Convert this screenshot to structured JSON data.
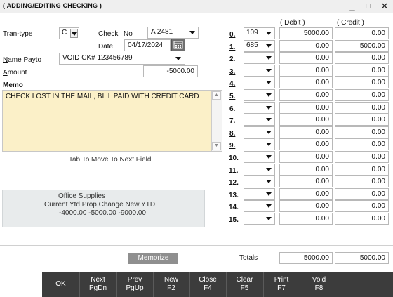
{
  "window": {
    "title": "( ADDING/EDITING CHECKING )",
    "minimize_glyph": "_",
    "maximize_glyph": "□",
    "close_glyph": "✕"
  },
  "form": {
    "trantype_label": "Tran-type",
    "trantype_value": "C",
    "check_label": "Check",
    "no_label": "No",
    "check_no_value": "A 2481",
    "date_label": "Date",
    "date_value": "04/17/2024",
    "payto_label": "Name Payto",
    "payto_value": "VOID CK# 123456789",
    "amount_label": "Amount",
    "amount_value": "-5000.00",
    "memo_label": "Memo",
    "memo_value": "CHECK LOST IN THE MAIL, BILL PAID WITH CREDIT CARD",
    "hint": "Tab To Move To Next Field"
  },
  "account_panel": {
    "name": "Office Supplies",
    "headers": "Current Ytd Prop.Change  New YTD.",
    "values": "-4000.00  -5000.00  -9000.00"
  },
  "grid": {
    "debit_header": "( Debit )",
    "credit_header": "( Credit )",
    "rows": [
      {
        "idx": "0.",
        "acct": "109",
        "debit": "5000.00",
        "credit": "0.00"
      },
      {
        "idx": "1.",
        "acct": "685",
        "debit": "0.00",
        "credit": "5000.00"
      },
      {
        "idx": "2.",
        "acct": "",
        "debit": "0.00",
        "credit": "0.00"
      },
      {
        "idx": "3.",
        "acct": "",
        "debit": "0.00",
        "credit": "0.00"
      },
      {
        "idx": "4.",
        "acct": "",
        "debit": "0.00",
        "credit": "0.00"
      },
      {
        "idx": "5.",
        "acct": "",
        "debit": "0.00",
        "credit": "0.00"
      },
      {
        "idx": "6.",
        "acct": "",
        "debit": "0.00",
        "credit": "0.00"
      },
      {
        "idx": "7.",
        "acct": "",
        "debit": "0.00",
        "credit": "0.00"
      },
      {
        "idx": "8.",
        "acct": "",
        "debit": "0.00",
        "credit": "0.00"
      },
      {
        "idx": "9.",
        "acct": "",
        "debit": "0.00",
        "credit": "0.00"
      },
      {
        "idx": "10.",
        "acct": "",
        "debit": "0.00",
        "credit": "0.00"
      },
      {
        "idx": "11.",
        "acct": "",
        "debit": "0.00",
        "credit": "0.00"
      },
      {
        "idx": "12.",
        "acct": "",
        "debit": "0.00",
        "credit": "0.00"
      },
      {
        "idx": "13.",
        "acct": "",
        "debit": "0.00",
        "credit": "0.00"
      },
      {
        "idx": "14.",
        "acct": "",
        "debit": "0.00",
        "credit": "0.00"
      },
      {
        "idx": "15.",
        "acct": "",
        "debit": "0.00",
        "credit": "0.00"
      }
    ],
    "totals_label": "Totals",
    "total_debit": "5000.00",
    "total_credit": "5000.00"
  },
  "memorize_label": "Memorize",
  "function_keys": [
    {
      "label": "OK",
      "name": "ok-button"
    },
    {
      "label": "Next\nPgDn",
      "name": "next-button"
    },
    {
      "label": "Prev\nPgUp",
      "name": "prev-button"
    },
    {
      "label": "New\nF2",
      "name": "new-button"
    },
    {
      "label": "Close\nF4",
      "name": "close-button"
    },
    {
      "label": "Clear\nF5",
      "name": "clear-button"
    },
    {
      "label": "Print\nF7",
      "name": "print-button"
    },
    {
      "label": "Void\nF8",
      "name": "void-button"
    }
  ],
  "colors": {
    "memo_bg": "#fbf0c8",
    "function_bar": "#3c3c3c",
    "memorize_button": "#8f8f8f"
  }
}
